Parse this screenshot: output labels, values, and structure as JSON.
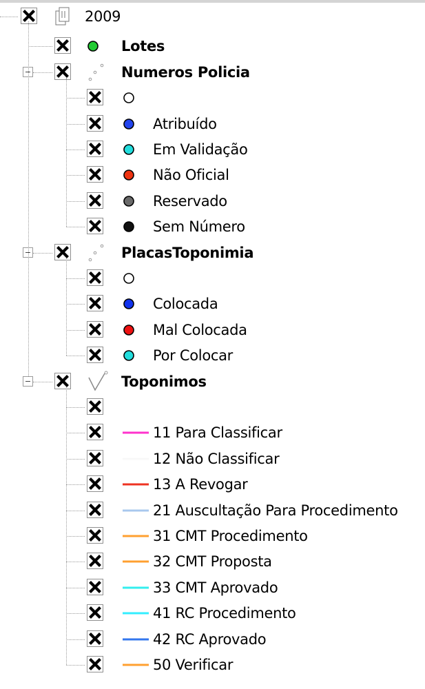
{
  "root": {
    "label": "2009",
    "checked": true
  },
  "layers": [
    {
      "label": "Lotes",
      "symbol": {
        "kind": "circle",
        "color": "#22cc33"
      },
      "checked": true,
      "children": []
    },
    {
      "label": "Numeros Policia",
      "symbol": {
        "kind": "points-icon"
      },
      "checked": true,
      "expanded": true,
      "children": [
        {
          "label": "",
          "symbol": {
            "kind": "circle",
            "color": "#ffffff"
          },
          "checked": true
        },
        {
          "label": "Atribuído",
          "symbol": {
            "kind": "circle",
            "color": "#2244ee"
          },
          "checked": true
        },
        {
          "label": "Em Validação",
          "symbol": {
            "kind": "circle",
            "color": "#22dddd"
          },
          "checked": true
        },
        {
          "label": "Não Oficial",
          "symbol": {
            "kind": "circle",
            "color": "#ee3311"
          },
          "checked": true
        },
        {
          "label": "Reservado",
          "symbol": {
            "kind": "circle",
            "color": "#6a6a6a"
          },
          "checked": true
        },
        {
          "label": "Sem Número",
          "symbol": {
            "kind": "circle",
            "color": "#111111"
          },
          "checked": true
        }
      ]
    },
    {
      "label": "PlacasToponimia",
      "symbol": {
        "kind": "points-icon"
      },
      "checked": true,
      "expanded": true,
      "children": [
        {
          "label": "",
          "symbol": {
            "kind": "circle",
            "color": "#ffffff"
          },
          "checked": true
        },
        {
          "label": "Colocada",
          "symbol": {
            "kind": "circle",
            "color": "#1133ee"
          },
          "checked": true
        },
        {
          "label": "Mal Colocada",
          "symbol": {
            "kind": "circle",
            "color": "#ee1111"
          },
          "checked": true
        },
        {
          "label": "Por Colocar",
          "symbol": {
            "kind": "circle",
            "color": "#22dddd"
          },
          "checked": true
        }
      ]
    },
    {
      "label": "Toponimos",
      "symbol": {
        "kind": "lines-icon"
      },
      "checked": true,
      "expanded": true,
      "children": [
        {
          "label": "",
          "symbol": {
            "kind": "none"
          },
          "checked": true
        },
        {
          "label": "11 Para Classificar",
          "symbol": {
            "kind": "line",
            "color": "#ff33cc"
          },
          "checked": true
        },
        {
          "label": "12 Não Classificar",
          "symbol": {
            "kind": "line",
            "color": "#f8f8f8"
          },
          "checked": true
        },
        {
          "label": "13 A Revogar",
          "symbol": {
            "kind": "line",
            "color": "#ee3322"
          },
          "checked": true
        },
        {
          "label": "21 Auscultação Para Procedimento",
          "symbol": {
            "kind": "line",
            "color": "#a8c8ee"
          },
          "checked": true
        },
        {
          "label": "31 CMT Procedimento",
          "symbol": {
            "kind": "line",
            "color": "#ffa030"
          },
          "checked": true
        },
        {
          "label": "32 CMT Proposta",
          "symbol": {
            "kind": "line",
            "color": "#ffa030"
          },
          "checked": true
        },
        {
          "label": "33 CMT Aprovado",
          "symbol": {
            "kind": "line",
            "color": "#33eeee"
          },
          "checked": true
        },
        {
          "label": "41 RC Procedimento",
          "symbol": {
            "kind": "line",
            "color": "#33eeff"
          },
          "checked": true
        },
        {
          "label": "42 RC Aprovado",
          "symbol": {
            "kind": "line",
            "color": "#3377ee"
          },
          "checked": true
        },
        {
          "label": "50 Verificar",
          "symbol": {
            "kind": "line",
            "color": "#ffa030"
          },
          "checked": true
        }
      ]
    }
  ]
}
